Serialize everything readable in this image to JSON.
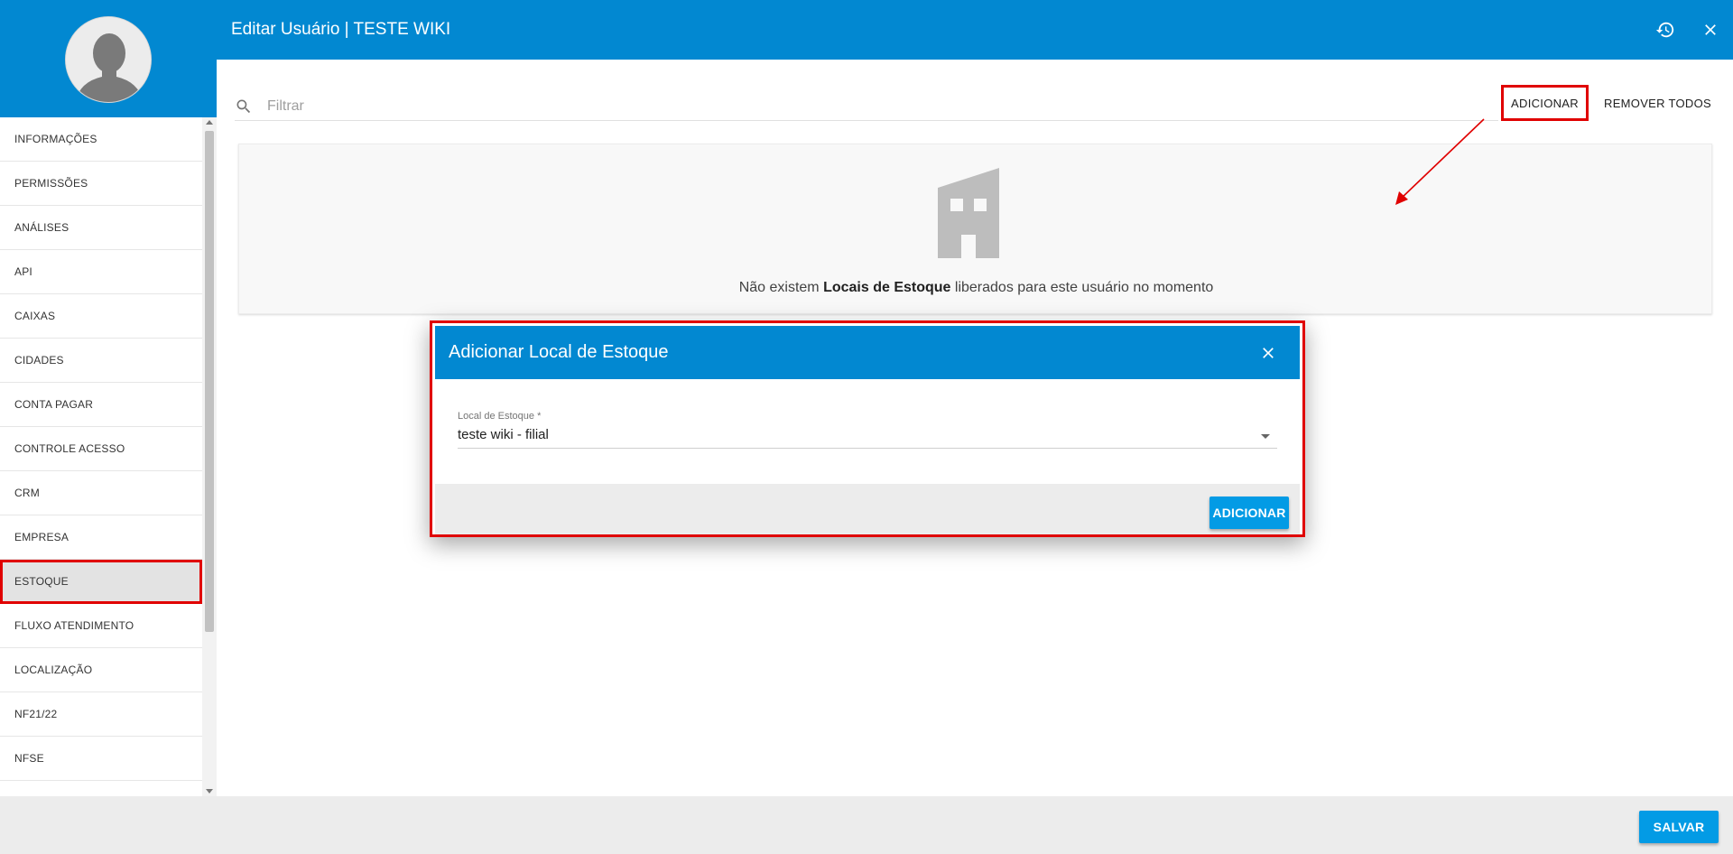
{
  "header": {
    "title": "Editar Usuário | TESTE WIKI",
    "history_icon": "history-icon",
    "close_icon": "close-icon",
    "color": "#0288d1"
  },
  "sidebar": {
    "items": [
      {
        "label": "INFORMAÇÕES"
      },
      {
        "label": "PERMISSÕES"
      },
      {
        "label": "ANÁLISES"
      },
      {
        "label": "API"
      },
      {
        "label": "CAIXAS"
      },
      {
        "label": "CIDADES"
      },
      {
        "label": "CONTA PAGAR"
      },
      {
        "label": "CONTROLE ACESSO"
      },
      {
        "label": "CRM"
      },
      {
        "label": "EMPRESA"
      },
      {
        "label": "ESTOQUE",
        "active": true
      },
      {
        "label": "FLUXO ATENDIMENTO"
      },
      {
        "label": "LOCALIZAÇÃO"
      },
      {
        "label": "NF21/22"
      },
      {
        "label": "NFSe"
      }
    ]
  },
  "toolbar": {
    "filter_placeholder": "Filtrar",
    "add_label": "ADICIONAR",
    "remove_all_label": "REMOVER TODOS"
  },
  "empty_state": {
    "icon": "building-icon",
    "text_before": "Não existem ",
    "text_bold": "Locais de Estoque",
    "text_after": " liberados para este usuário no momento"
  },
  "dialog": {
    "title": "Adicionar Local de Estoque",
    "field_label": "Local de Estoque *",
    "field_value": "teste wiki - filial",
    "add_label": "ADICIONAR"
  },
  "footer": {
    "save_label": "SALVAR"
  },
  "colors": {
    "primary": "#0288d1",
    "button": "#039be5",
    "highlight": "#e00000"
  }
}
